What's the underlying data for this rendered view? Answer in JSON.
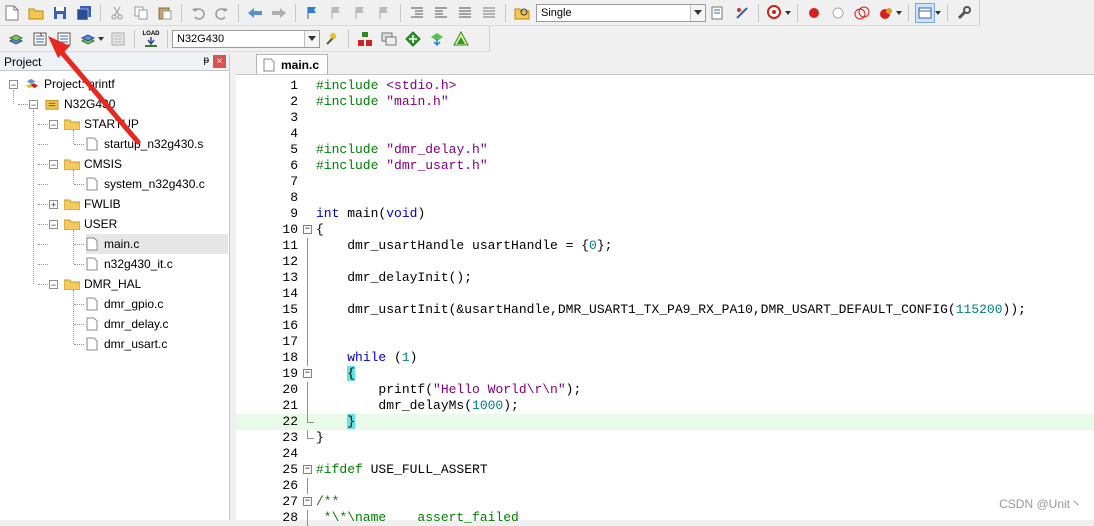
{
  "toolbar": {
    "target_mode": "Single",
    "device_select": "N32G430",
    "load_label": "LOAD"
  },
  "project": {
    "title": "Project",
    "pin": "ᵽ",
    "close": "×",
    "root": "Project: printf",
    "target": "N32G430",
    "groups": [
      {
        "name": "STARTUP",
        "files": [
          "startup_n32g430.s"
        ]
      },
      {
        "name": "CMSIS",
        "files": [
          "system_n32g430.c"
        ]
      },
      {
        "name": "FWLIB",
        "files": []
      },
      {
        "name": "USER",
        "files": [
          "main.c",
          "n32g430_it.c"
        ]
      },
      {
        "name": "DMR_HAL",
        "files": [
          "dmr_gpio.c",
          "dmr_delay.c",
          "dmr_usart.c"
        ]
      }
    ]
  },
  "editor": {
    "tab": "main.c",
    "lines": [
      {
        "n": "1",
        "t": "#include <stdio.h>"
      },
      {
        "n": "2",
        "t": "#include \"main.h\""
      },
      {
        "n": "3",
        "t": ""
      },
      {
        "n": "4",
        "t": ""
      },
      {
        "n": "5",
        "t": "#include \"dmr_delay.h\""
      },
      {
        "n": "6",
        "t": "#include \"dmr_usart.h\""
      },
      {
        "n": "7",
        "t": ""
      },
      {
        "n": "8",
        "t": ""
      },
      {
        "n": "9",
        "t": "int main(void)"
      },
      {
        "n": "10",
        "t": "{"
      },
      {
        "n": "11",
        "t": "    dmr_usartHandle usartHandle = {0};"
      },
      {
        "n": "12",
        "t": ""
      },
      {
        "n": "13",
        "t": "    dmr_delayInit();"
      },
      {
        "n": "14",
        "t": ""
      },
      {
        "n": "15",
        "t": "    dmr_usartInit(&usartHandle,DMR_USART1_TX_PA9_RX_PA10,DMR_USART_DEFAULT_CONFIG(115200));"
      },
      {
        "n": "16",
        "t": ""
      },
      {
        "n": "17",
        "t": ""
      },
      {
        "n": "18",
        "t": "    while (1)"
      },
      {
        "n": "19",
        "t": "    {"
      },
      {
        "n": "20",
        "t": "        printf(\"Hello World\\r\\n\");"
      },
      {
        "n": "21",
        "t": "        dmr_delayMs(1000);"
      },
      {
        "n": "22",
        "t": "    }"
      },
      {
        "n": "23",
        "t": "}"
      },
      {
        "n": "24",
        "t": ""
      },
      {
        "n": "25",
        "t": "#ifdef USE_FULL_ASSERT"
      },
      {
        "n": "26",
        "t": ""
      },
      {
        "n": "27",
        "t": "/**"
      },
      {
        "n": "28",
        "t": " *\\*\\name    assert_failed"
      }
    ]
  },
  "watermark": "CSDN @Unit丶"
}
